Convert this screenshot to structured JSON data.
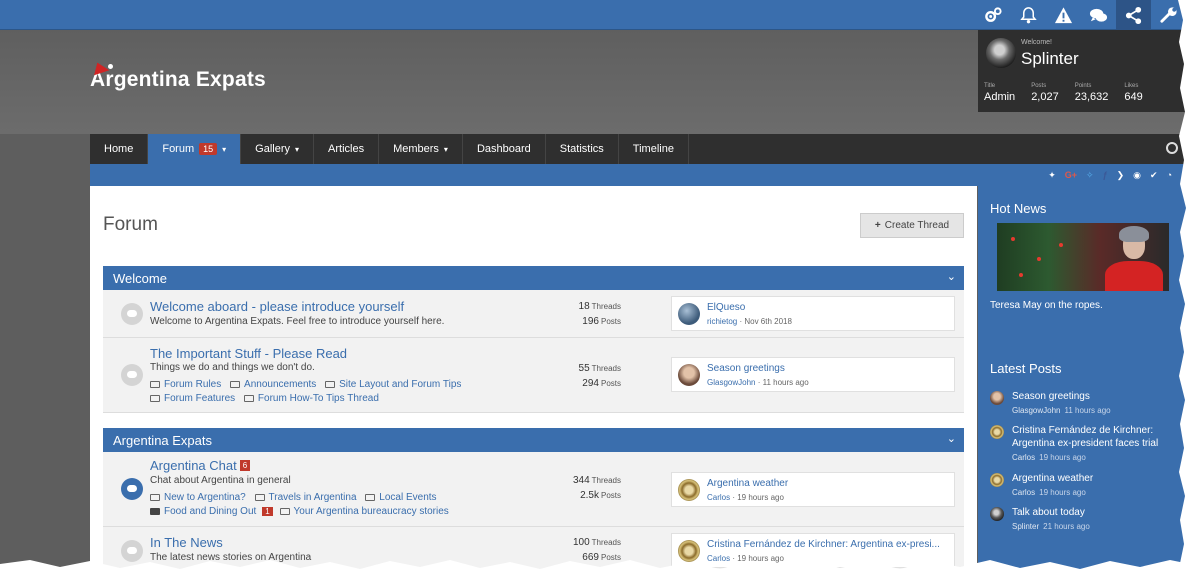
{
  "site": {
    "logo_text": "Argentina Expats"
  },
  "topbar_icons": [
    "cogs-icon",
    "bell-icon",
    "warning-icon",
    "chat-icon",
    "share-icon",
    "wrench-icon"
  ],
  "user": {
    "welcome": "Welcome!",
    "name": "Splinter",
    "stats": [
      {
        "label": "Title",
        "value": "Admin"
      },
      {
        "label": "Posts",
        "value": "2,027"
      },
      {
        "label": "Points",
        "value": "23,632"
      },
      {
        "label": "Likes",
        "value": "649"
      }
    ]
  },
  "nav": {
    "home": "Home",
    "forum": "Forum",
    "forum_badge": "15",
    "gallery": "Gallery",
    "articles": "Articles",
    "members": "Members",
    "dashboard": "Dashboard",
    "statistics": "Statistics",
    "timeline": "Timeline"
  },
  "subbar_icons": {
    "gplus": "G+"
  },
  "main": {
    "title": "Forum",
    "create_thread": "Create Thread",
    "categories": [
      {
        "name": "Welcome",
        "forums": [
          {
            "title": "Welcome aboard - please introduce yourself",
            "description": "Welcome to Argentina Expats. Feel free to introduce yourself here.",
            "threads": "18",
            "posts": "196",
            "last_title": "ElQueso",
            "last_author": "richietog",
            "last_time": "Nov 6th 2018"
          },
          {
            "title": "The Important Stuff - Please Read",
            "description": "Things we do and things we don't do.",
            "sublinks": [
              "Forum Rules",
              "Announcements",
              "Site Layout and Forum Tips",
              "Forum Features",
              "Forum How-To Tips Thread"
            ],
            "threads": "55",
            "posts": "294",
            "last_title": "Season greetings",
            "last_author": "GlasgowJohn",
            "last_time": "11 hours ago"
          }
        ]
      },
      {
        "name": "Argentina Expats",
        "forums": [
          {
            "title": "Argentina Chat",
            "badge": "6",
            "description": "Chat about Argentina in general",
            "sublinks": [
              "New to Argentina?",
              "Travels in Argentina",
              "Local Events",
              "Food and Dining Out",
              "Your Argentina bureaucracy stories"
            ],
            "sublink_badge": "1",
            "threads": "344",
            "posts": "2.5k",
            "last_title": "Argentina weather",
            "last_author": "Carlos",
            "last_time": "19 hours ago"
          },
          {
            "title": "In The News",
            "description": "The latest news stories on Argentina",
            "threads": "100",
            "posts": "669",
            "last_title": "Cristina Fernández de Kirchner: Argentina ex-presi...",
            "last_author": "Carlos",
            "last_time": "19 hours ago"
          }
        ]
      }
    ],
    "labels": {
      "threads": "Threads",
      "posts": "Posts",
      "separator": " · "
    }
  },
  "sidebar": {
    "hot_news_title": "Hot News",
    "hot_news_caption": "Teresa May on the ropes.",
    "latest_posts_title": "Latest Posts",
    "latest_posts": [
      {
        "title": "Season greetings",
        "author": "GlasgowJohn",
        "time": "11 hours ago"
      },
      {
        "title": "Cristina Fernández de Kirchner: Argentina ex-president faces trial",
        "author": "Carlos",
        "time": "19 hours ago"
      },
      {
        "title": "Argentina weather",
        "author": "Carlos",
        "time": "19 hours ago"
      },
      {
        "title": "Talk about today",
        "author": "Splinter",
        "time": "21 hours ago"
      }
    ]
  }
}
